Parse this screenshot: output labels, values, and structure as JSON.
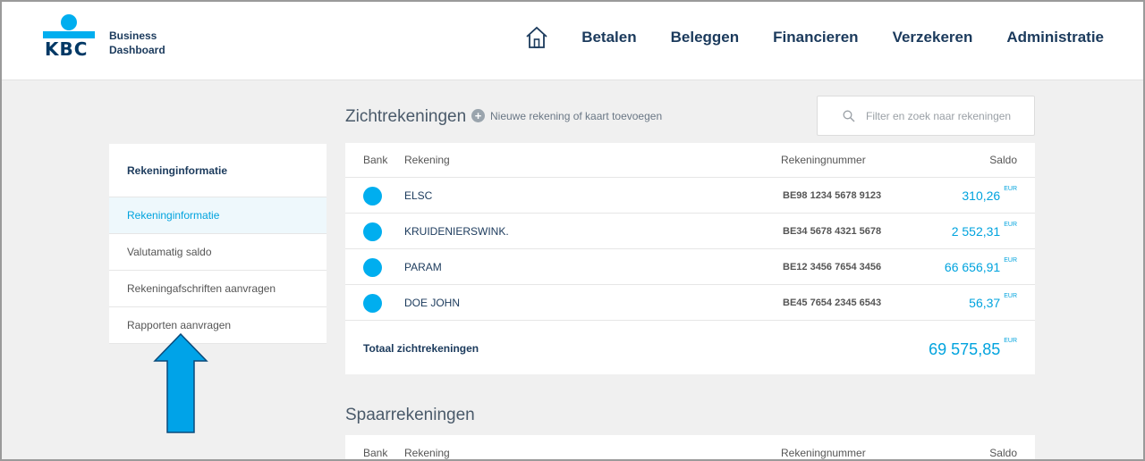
{
  "brand": {
    "logo_text": "KBC",
    "line1": "Business",
    "line2": "Dashboard"
  },
  "nav": {
    "home_icon": "home-icon",
    "items": [
      "Betalen",
      "Beleggen",
      "Financieren",
      "Verzekeren",
      "Administratie"
    ]
  },
  "sidebar": {
    "header": "Rekeninginformatie",
    "items": [
      {
        "label": "Rekeninginformatie",
        "active": true
      },
      {
        "label": "Valutamatig saldo"
      },
      {
        "label": "Rekeningafschriften aanvragen"
      },
      {
        "label": "Rapporten aanvragen"
      }
    ]
  },
  "annotation": {
    "arrow_color": "#00a3e8",
    "arrow_icon": "up-arrow-icon"
  },
  "current_accounts": {
    "title": "Zichtrekeningen",
    "add_label": "Nieuwe rekening of kaart toevoegen",
    "search_placeholder": "Filter en zoek naar rekeningen",
    "columns": {
      "bank": "Bank",
      "account": "Rekening",
      "number": "Rekeningnummer",
      "balance": "Saldo"
    },
    "rows": [
      {
        "name": "ELSC",
        "number": "BE98 1234 5678 9123",
        "balance": "310,26",
        "currency": "EUR"
      },
      {
        "name": "KRUIDENIERSWINK.",
        "number": "BE34 5678 4321 5678",
        "balance": "2 552,31",
        "currency": "EUR"
      },
      {
        "name": "PARAM",
        "number": "BE12 3456 7654 3456",
        "balance": "66 656,91",
        "currency": "EUR"
      },
      {
        "name": "DOE JOHN",
        "number": "BE45 7654 2345 6543",
        "balance": "56,37",
        "currency": "EUR"
      }
    ],
    "total_label": "Totaal zichtrekeningen",
    "total_value": "69 575,85",
    "total_currency": "EUR"
  },
  "savings_accounts": {
    "title": "Spaarrekeningen",
    "columns": {
      "bank": "Bank",
      "account": "Rekening",
      "number": "Rekeningnummer",
      "balance": "Saldo"
    }
  },
  "colors": {
    "brand_blue": "#00aeef",
    "navy": "#1b3a5c",
    "accent": "#00a3de"
  }
}
